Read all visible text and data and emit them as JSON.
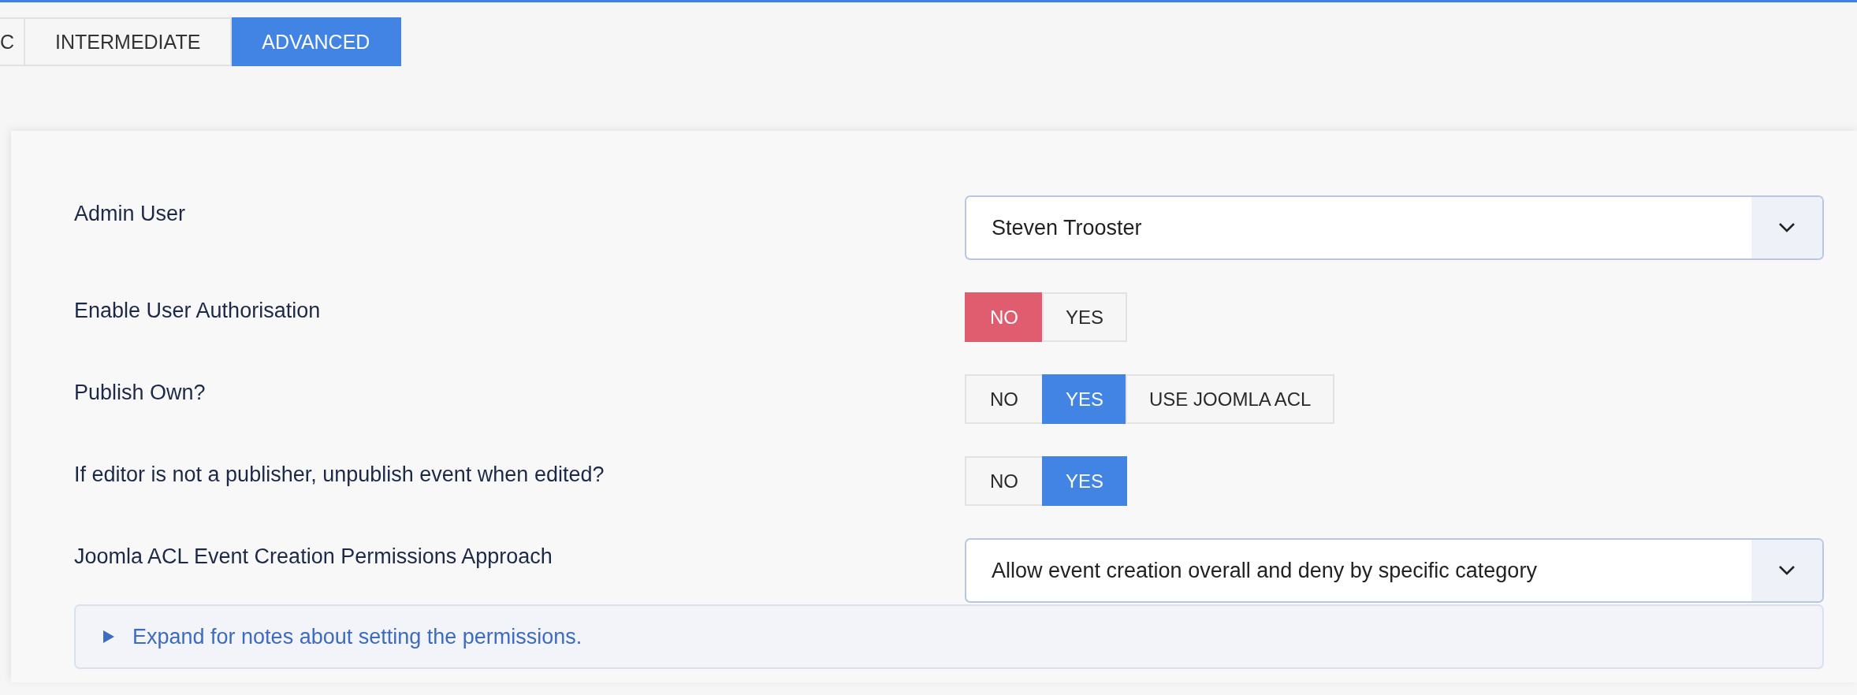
{
  "tabs": [
    {
      "label": "C",
      "selected": false
    },
    {
      "label": "INTERMEDIATE",
      "selected": false
    },
    {
      "label": "ADVANCED",
      "selected": true
    }
  ],
  "fields": [
    {
      "kind": "select",
      "label": "Admin User",
      "value": "Steven Trooster"
    },
    {
      "kind": "toggle",
      "label": "Enable User Authorisation",
      "options": [
        {
          "label": "NO",
          "kind": "negative",
          "selected": true
        },
        {
          "label": "YES",
          "kind": "positive",
          "selected": false
        }
      ]
    },
    {
      "kind": "toggle",
      "label": "Publish Own?",
      "options": [
        {
          "label": "NO",
          "kind": "negative",
          "selected": false
        },
        {
          "label": "YES",
          "kind": "positive",
          "selected": true
        },
        {
          "label": "USE JOOMLA ACL",
          "kind": "positive",
          "selected": false
        }
      ]
    },
    {
      "kind": "toggle",
      "label": "If editor is not a publisher, unpublish event when edited?",
      "options": [
        {
          "label": "NO",
          "kind": "negative",
          "selected": false
        },
        {
          "label": "YES",
          "kind": "positive",
          "selected": true
        }
      ]
    },
    {
      "kind": "select",
      "label": "Joomla ACL Event Creation Permissions Approach",
      "value": "Allow event creation overall and deny by specific category"
    }
  ],
  "notes": {
    "label": "Expand for notes about setting the permissions.",
    "expanded": false
  }
}
